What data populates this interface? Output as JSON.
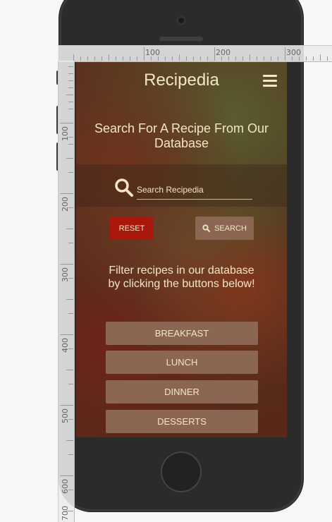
{
  "app": {
    "title": "Recipedia"
  },
  "hero": {
    "headline": "Search For A Recipe From Our Database"
  },
  "search": {
    "placeholder": "Search Recipedia",
    "reset_label": "RESET",
    "search_label": "SEARCH"
  },
  "filter": {
    "instructions": "Filter recipes in our database by clicking the buttons below!",
    "buttons": [
      "BREAKFAST",
      "LUNCH",
      "DINNER",
      "DESSERTS"
    ]
  },
  "rulers": {
    "top_labels": [
      "100",
      "200",
      "300"
    ],
    "left_labels": [
      "100",
      "200",
      "300",
      "400",
      "500",
      "600",
      "700"
    ]
  },
  "colors": {
    "accent_red": "#a8180d",
    "button_brown": "#8a6653",
    "text_cream": "#f3e6c6"
  },
  "icons": {
    "menu": "hamburger-icon",
    "search": "magnifier-icon"
  }
}
